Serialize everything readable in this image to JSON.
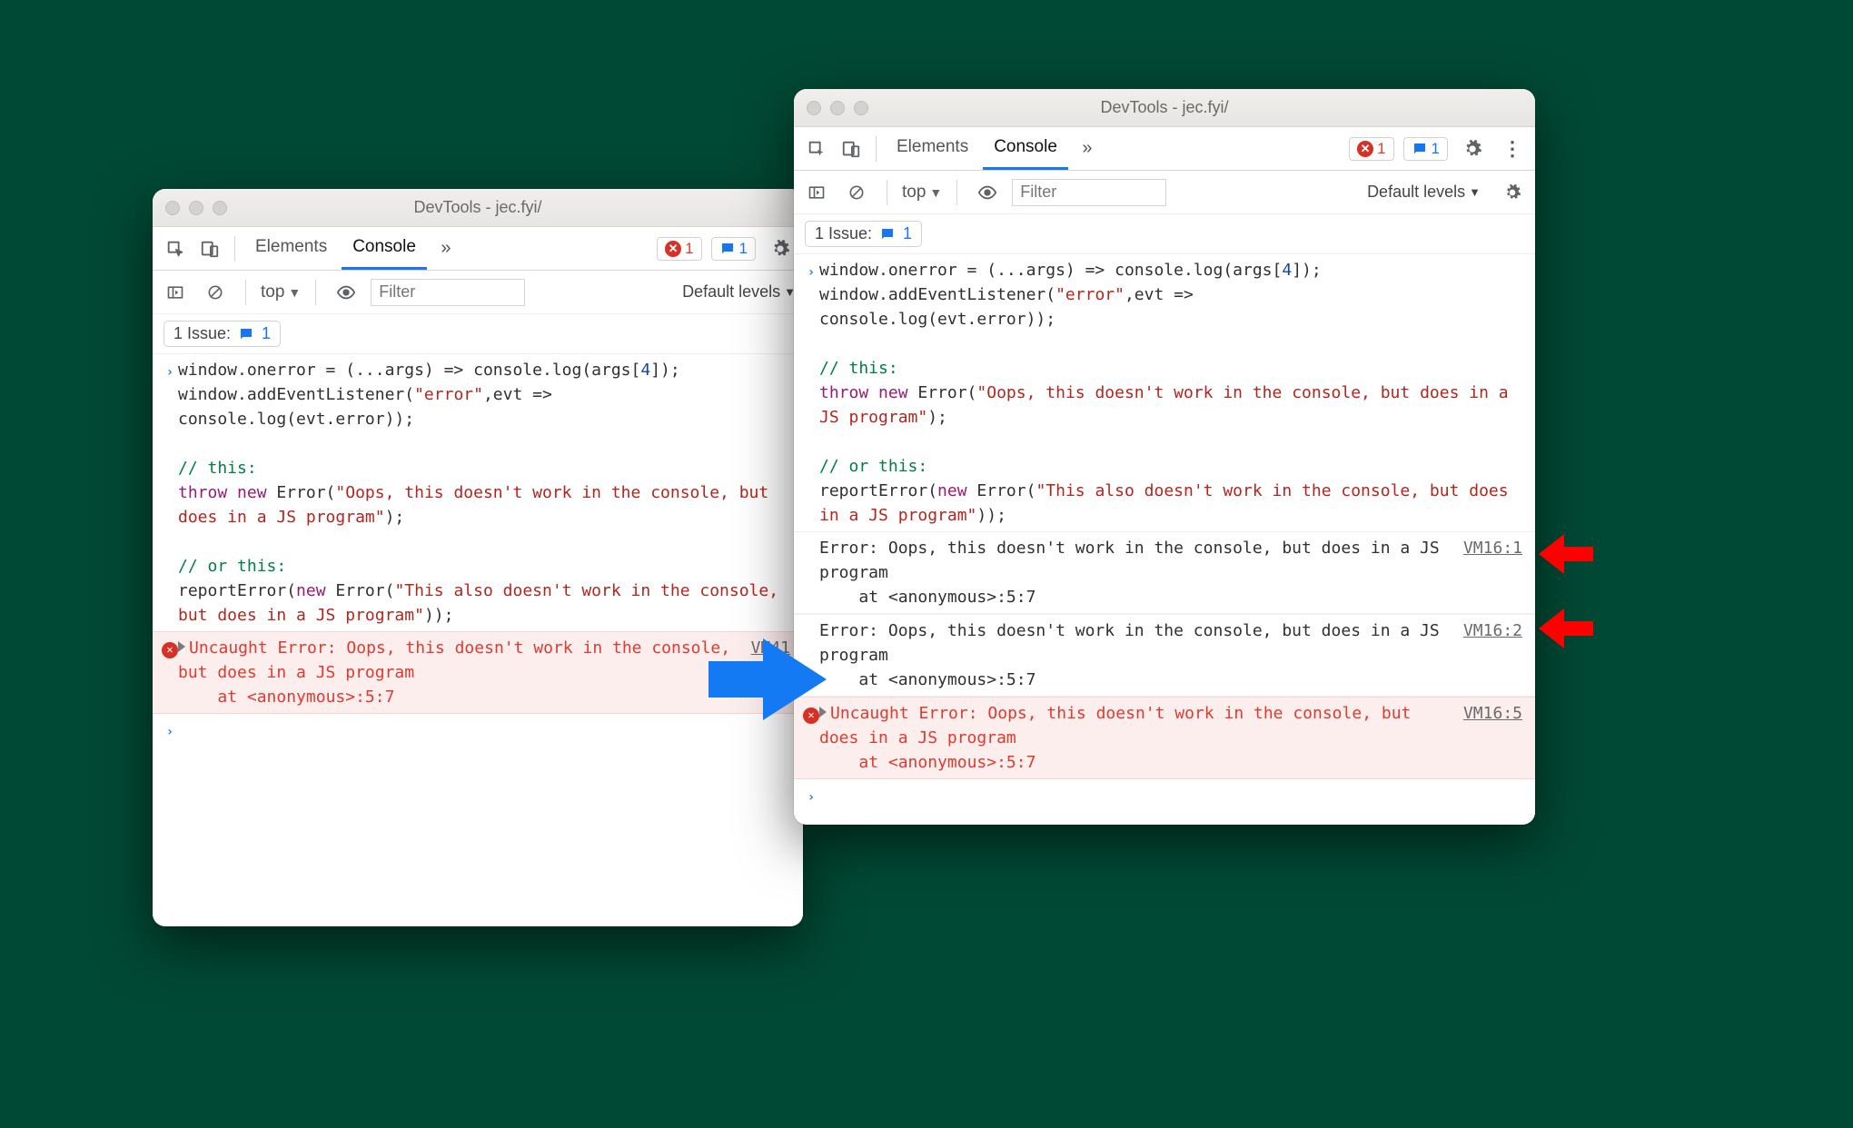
{
  "app_title": "DevTools - jec.fyi/",
  "tabs": {
    "elements": "Elements",
    "console": "Console"
  },
  "badges": {
    "error_count": "1",
    "issue_count": "1"
  },
  "filterbar": {
    "context": "top",
    "filter_placeholder": "Filter",
    "levels_label": "Default levels"
  },
  "issuebar": {
    "label": "1 Issue:",
    "count": "1"
  },
  "code": {
    "c1": "window.onerror = (...args) => console.log(args[",
    "c1n": "4",
    "c1b": "]);",
    "c2": "window.addEventListener(",
    "c2s": "\"error\"",
    "c2b": ",evt =>",
    "c3": "console.log(evt.error));",
    "c4": "// this:",
    "c5a": "throw",
    "c5b": " new ",
    "c5c": "Error(",
    "c5s": "\"Oops, this doesn't work in the console, but does in a JS program\"",
    "c5d": ");",
    "c6": "// or this:",
    "c7a": "reportError(",
    "c7b": "new ",
    "c7c": "Error(",
    "c7s": "\"This also doesn't work in the console, but does in a JS program\"",
    "c7d": "));"
  },
  "left": {
    "err1": "Uncaught Error: Oops, this doesn't work in the console, but does in a JS program",
    "err1b": "    at <anonymous>:5:7",
    "src1": "VM41"
  },
  "right": {
    "log1": "Error: Oops, this doesn't work in the console, but does in a JS program",
    "log1b": "    at <anonymous>:5:7",
    "src1": "VM16:1",
    "log2": "Error: Oops, this doesn't work in the console, but does in a JS program",
    "log2b": "    at <anonymous>:5:7",
    "src2": "VM16:2",
    "err1": "Uncaught Error: Oops, this doesn't work in the console, but does in a JS program",
    "err1b": "    at <anonymous>:5:7",
    "srcerr": "VM16:5"
  }
}
